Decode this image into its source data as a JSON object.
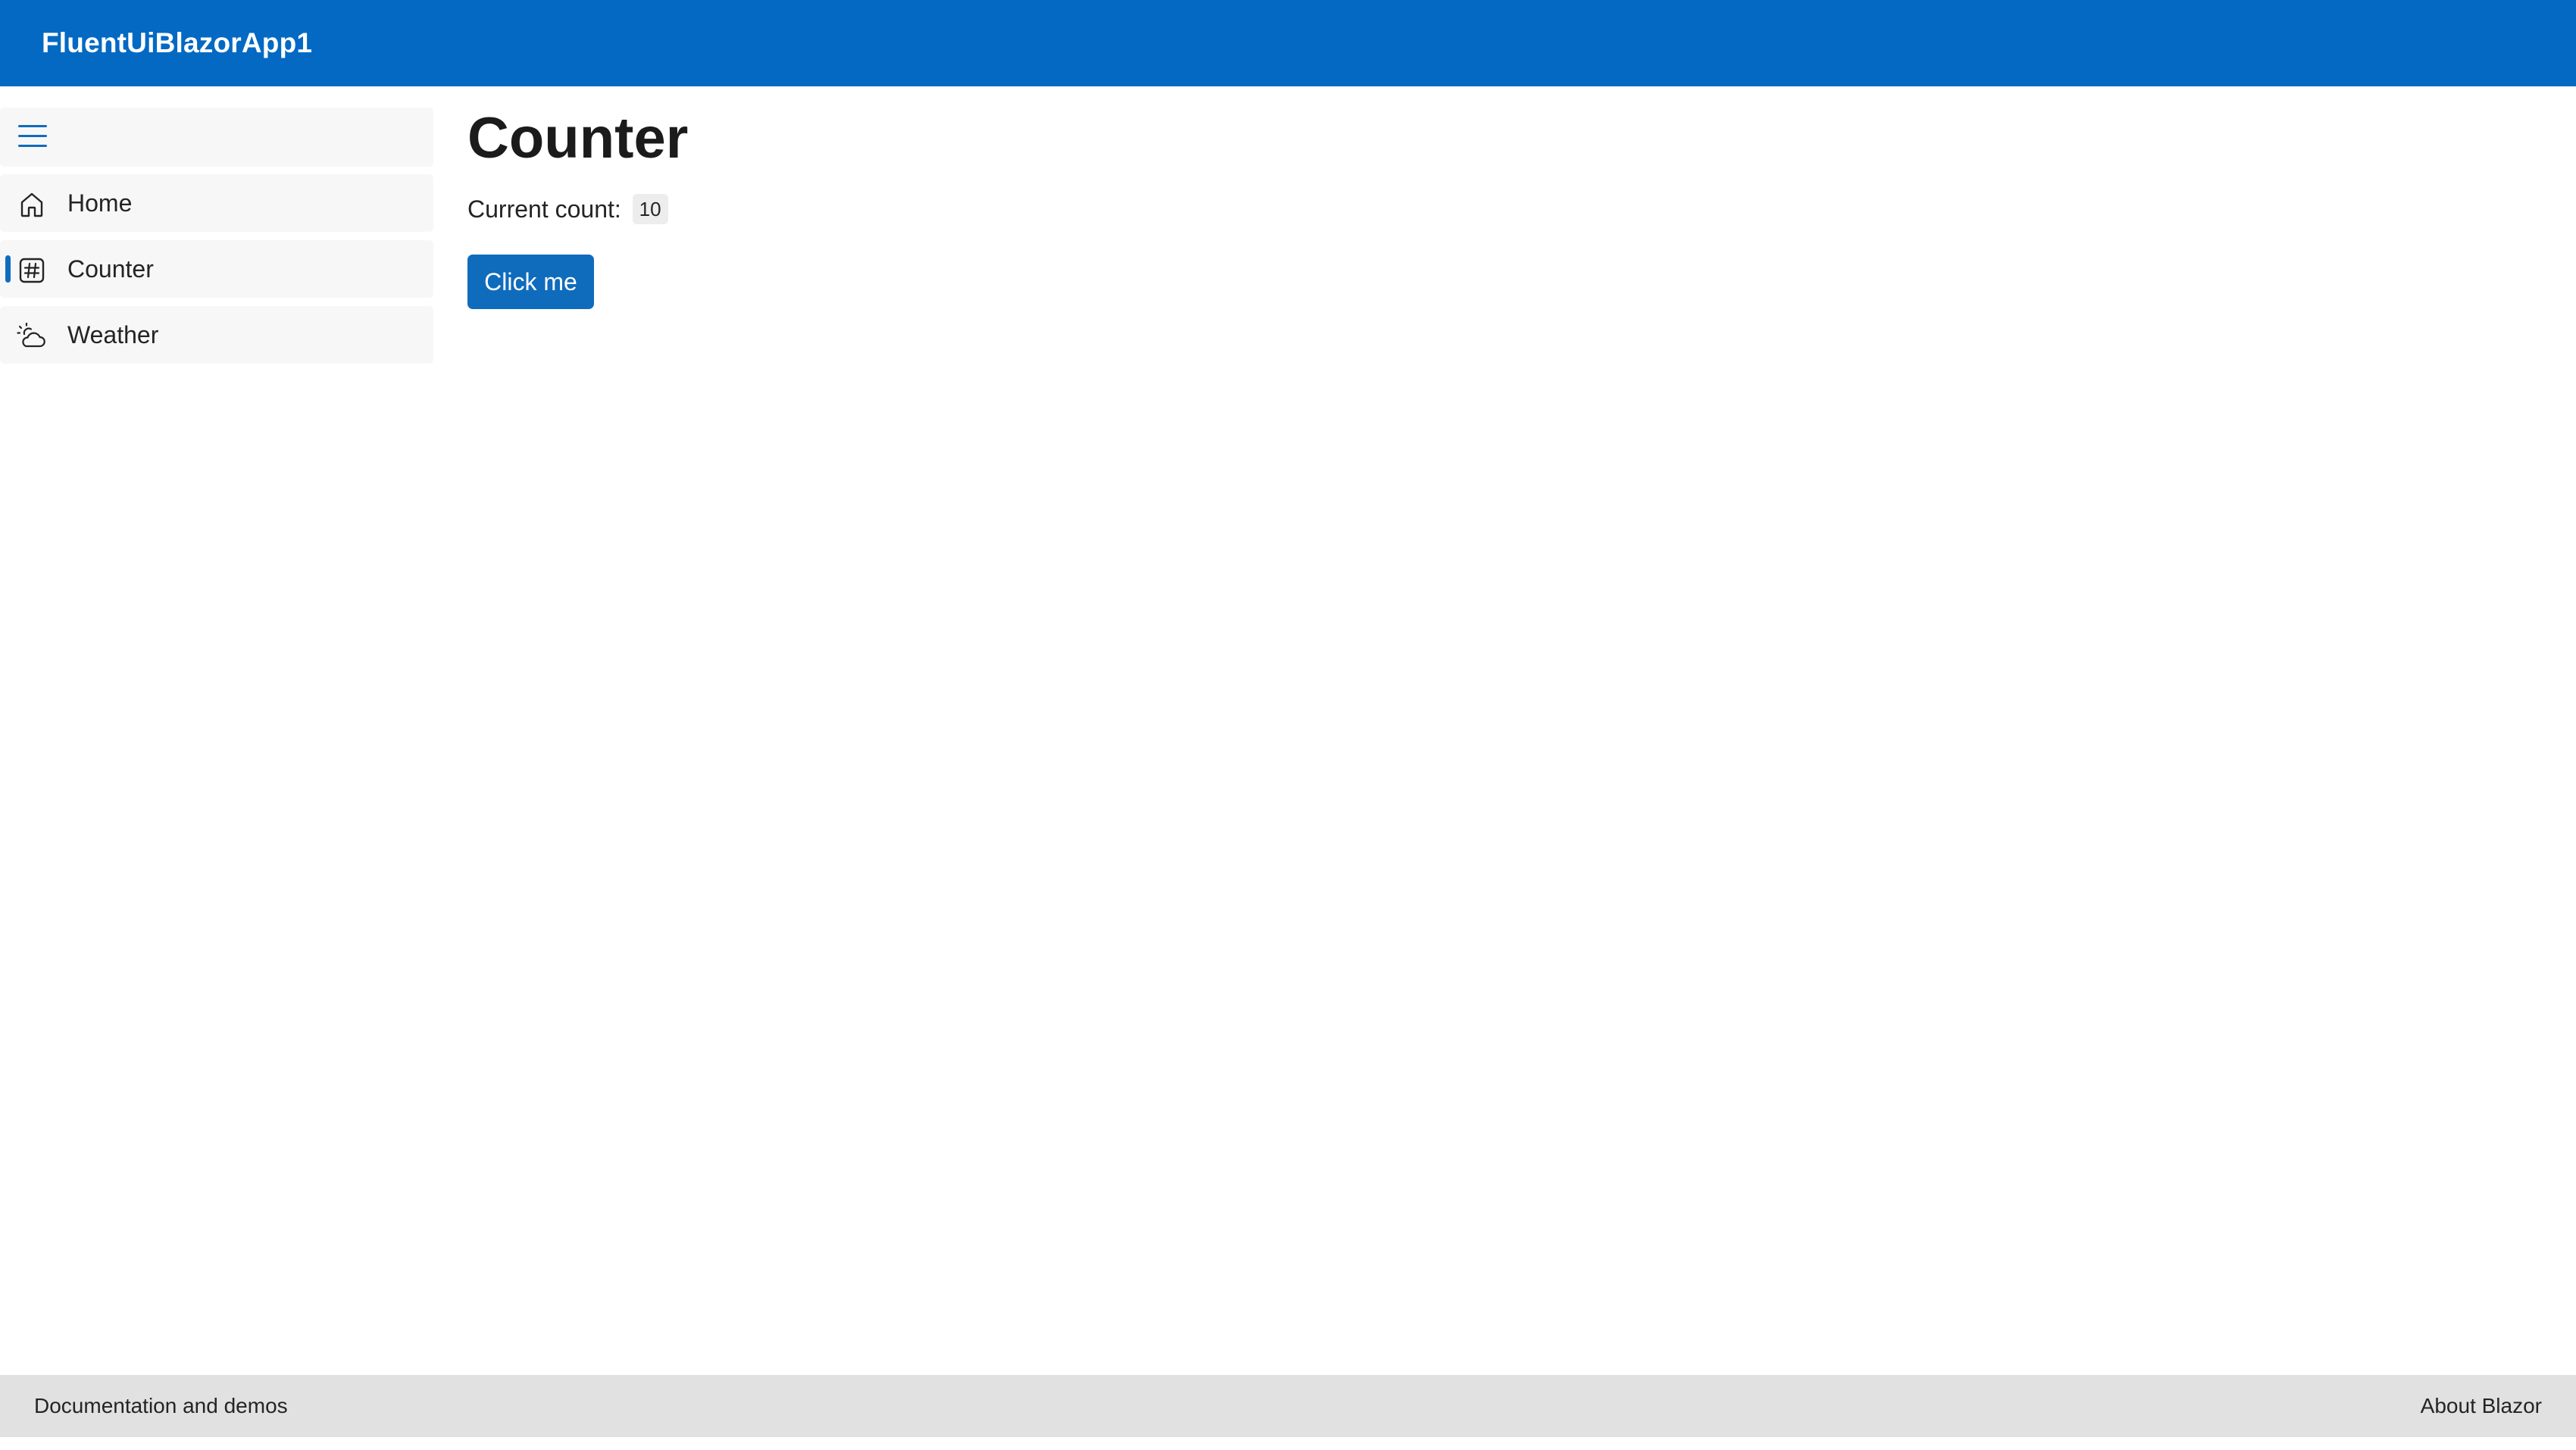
{
  "header": {
    "app_title": "FluentUiBlazorApp1"
  },
  "sidebar": {
    "toggle_icon": "hamburger-menu-icon",
    "items": [
      {
        "label": "Home",
        "icon": "home-icon",
        "active": false
      },
      {
        "label": "Counter",
        "icon": "number-symbol-icon",
        "active": true
      },
      {
        "label": "Weather",
        "icon": "weather-partly-cloudy-icon",
        "active": false
      }
    ]
  },
  "main": {
    "title": "Counter",
    "count_label": "Current count:",
    "count_value": "10",
    "button_label": "Click me"
  },
  "footer": {
    "left_link": "Documentation and demos",
    "right_link": "About Blazor"
  },
  "colors": {
    "header_bg": "#0369c3",
    "accent": "#0f6cbd",
    "footer_bg": "#e1e1e1",
    "nav_bg": "#f7f7f7"
  }
}
